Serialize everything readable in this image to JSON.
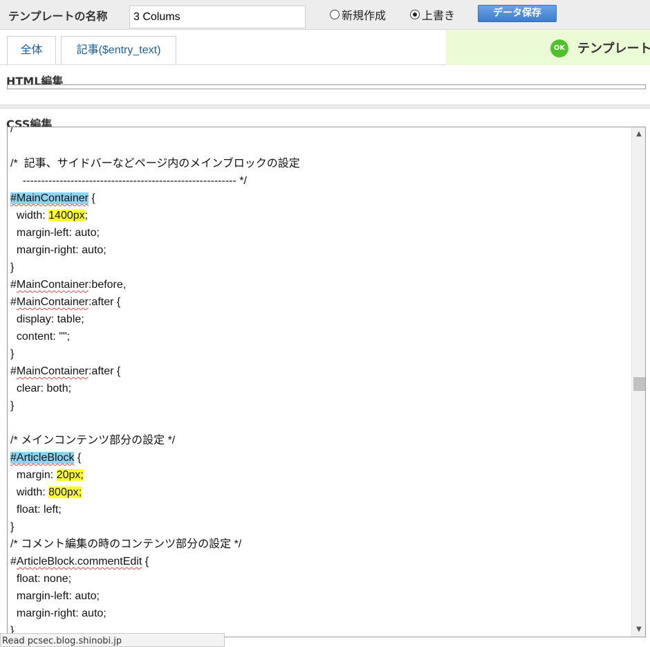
{
  "header": {
    "template_name_label": "テンプレートの名称",
    "template_name_value": "3 Colums",
    "radio_new": "新規作成",
    "radio_overwrite": "上書き",
    "overwrite_selected": true,
    "save_button": "データ保存"
  },
  "tabs": [
    {
      "label": "全体"
    },
    {
      "label": "記事($entry_text)"
    }
  ],
  "notice": {
    "badge": "OK",
    "text": "テンプレート"
  },
  "sections": {
    "html_title": "HTML編集",
    "css_title": "CSS編集"
  },
  "status_bar": {
    "text": "Read pcsec.blog.shinobi.jp"
  },
  "colors": {
    "selection": "#8fd3f2",
    "highlight": "#ffff2e",
    "ok_green": "#4fc12b",
    "notice_bg": "#eafbd6",
    "save_blue": "#3f7ccb"
  },
  "css_lines": [
    [
      {
        "t": "/"
      }
    ],
    [
      {
        "t": ""
      }
    ],
    [
      {
        "t": "/*  記事、サイドバーなどページ内のメインブロックの設定"
      }
    ],
    [
      {
        "t": "    ---------------------------------------------------------- */"
      }
    ],
    [
      {
        "t": "#MainContainer",
        "c": "hl-sel squig"
      },
      {
        "t": " {"
      }
    ],
    [
      {
        "t": "  width: "
      },
      {
        "t": "1400px",
        "c": "hl-y"
      },
      {
        "t": ";"
      }
    ],
    [
      {
        "t": "  margin-left: auto;"
      }
    ],
    [
      {
        "t": "  margin-right: auto;"
      }
    ],
    [
      {
        "t": "}"
      }
    ],
    [
      {
        "t": "#"
      },
      {
        "t": "MainContainer",
        "c": "squig"
      },
      {
        "t": ":before,"
      }
    ],
    [
      {
        "t": "#"
      },
      {
        "t": "MainContainer",
        "c": "squig"
      },
      {
        "t": ":after {"
      }
    ],
    [
      {
        "t": "  display: table;"
      }
    ],
    [
      {
        "t": "  content: \"\";"
      }
    ],
    [
      {
        "t": "}"
      }
    ],
    [
      {
        "t": "#"
      },
      {
        "t": "MainContainer",
        "c": "squig"
      },
      {
        "t": ":after {"
      }
    ],
    [
      {
        "t": "  clear: both;"
      }
    ],
    [
      {
        "t": "}"
      }
    ],
    [
      {
        "t": ""
      }
    ],
    [
      {
        "t": "/* メインコンテンツ部分の設定 */"
      }
    ],
    [
      {
        "t": "#ArticleBlock",
        "c": "hl-sel squig"
      },
      {
        "t": " {"
      }
    ],
    [
      {
        "t": "  margin: "
      },
      {
        "t": "20px;",
        "c": "hl-y"
      }
    ],
    [
      {
        "t": "  width: "
      },
      {
        "t": "800px;",
        "c": "hl-y"
      }
    ],
    [
      {
        "t": "  float: left;"
      }
    ],
    [
      {
        "t": "}"
      }
    ],
    [
      {
        "t": "/* コメント編集の時のコンテンツ部分の設定 */"
      }
    ],
    [
      {
        "t": "#"
      },
      {
        "t": "ArticleBlock.commentEdit",
        "c": "squig"
      },
      {
        "t": " {"
      }
    ],
    [
      {
        "t": "  float: none;"
      }
    ],
    [
      {
        "t": "  margin-left: auto;"
      }
    ],
    [
      {
        "t": "  margin-right: auto;"
      }
    ],
    [
      {
        "t": "}"
      }
    ]
  ]
}
